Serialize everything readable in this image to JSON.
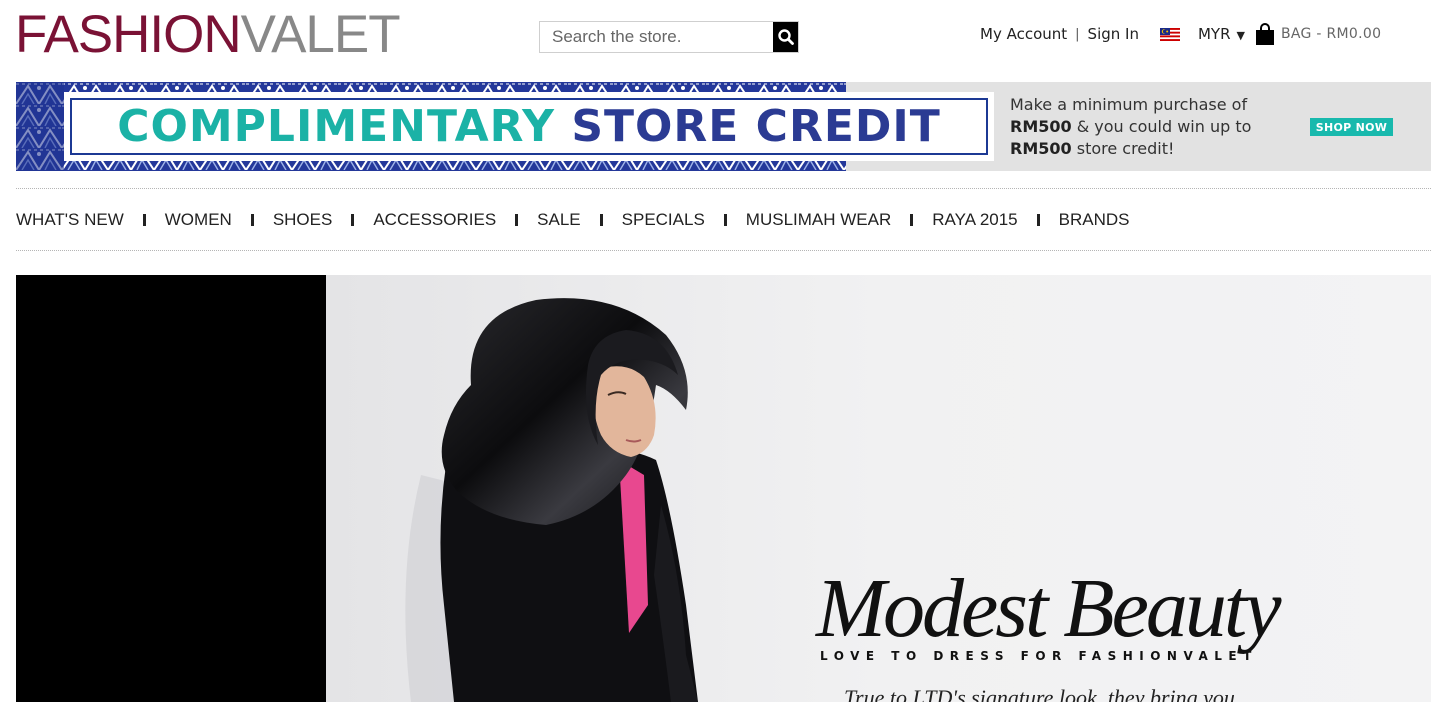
{
  "header": {
    "logo_part1": "FASHION",
    "logo_part2": "VALET",
    "search_placeholder": "Search the store.",
    "my_account": "My Account",
    "separator": "|",
    "sign_in": "Sign In",
    "currency": "MYR",
    "currency_caret": "▼",
    "bag_label": "BAG - RM0.00"
  },
  "promo": {
    "headline_part1": "COMPLIMENTARY",
    "headline_part2": "STORE CREDIT",
    "desc_line1": "Make a minimum purchase of",
    "desc_line2_bold": "RM500",
    "desc_line2_rest": " & you could win up to",
    "desc_line3_bold": "RM500",
    "desc_line3_rest": " store credit!",
    "cta": "SHOP NOW",
    "colors": {
      "teal": "#1bb2a6",
      "navy": "#2b3b93",
      "pattern_blue": "#24389a"
    }
  },
  "nav": {
    "items": [
      "WHAT'S NEW",
      "WOMEN",
      "SHOES",
      "ACCESSORIES",
      "SALE",
      "SPECIALS",
      "MUSLIMAH WEAR",
      "RAYA 2015",
      "BRANDS"
    ]
  },
  "hero": {
    "title": "Modest Beauty",
    "subtitle": "LOVE TO DRESS FOR FASHIONVALET",
    "body": "True to LTD's signature look, they bring you"
  },
  "colors": {
    "brand_maroon": "#7a1235",
    "logo_gray": "#888888",
    "search_button": "#000000"
  }
}
